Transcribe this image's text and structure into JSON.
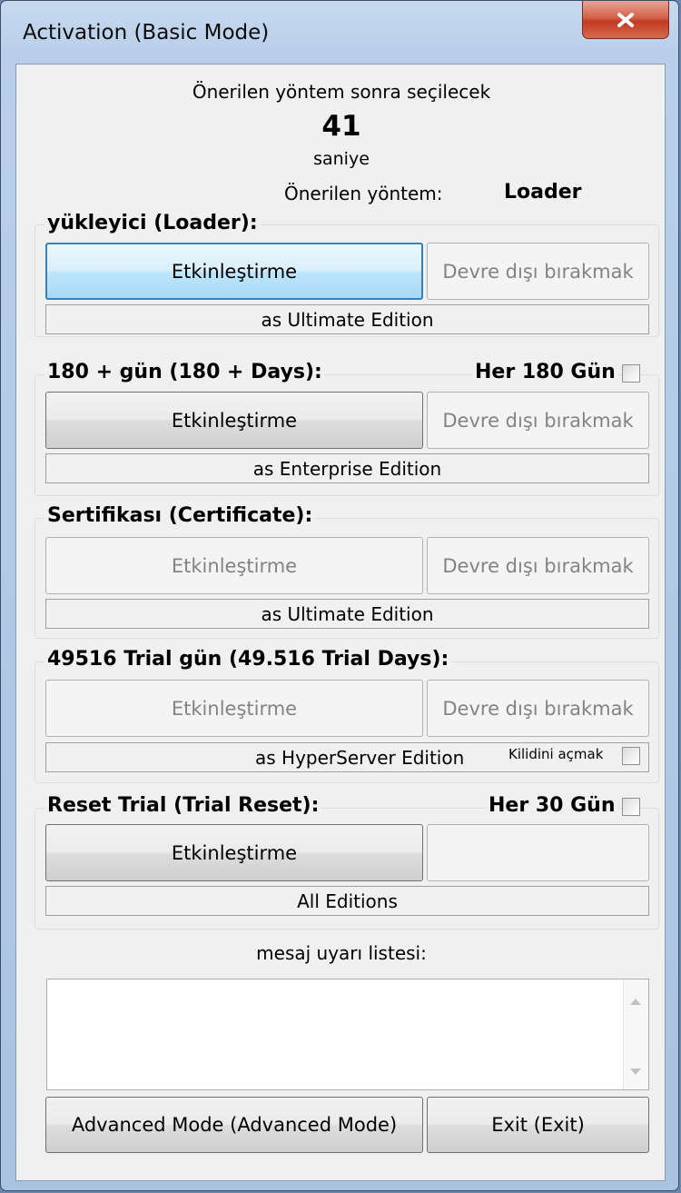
{
  "window": {
    "title": "Activation (Basic Mode)",
    "close_glyph": "x"
  },
  "countdown": {
    "label": "Önerilen yöntem sonra seçilecek",
    "seconds": "41",
    "unit": "saniye",
    "recommended_label": "Önerilen yöntem:",
    "recommended_value": "Loader"
  },
  "sections": {
    "loader": {
      "title": "yükleyici  (Loader):",
      "activate": "Etkinleştirme",
      "deactivate": "Devre dışı bırakmak",
      "edition": "as Ultimate Edition"
    },
    "days180": {
      "title": "180 +  gün (180 +  Days):",
      "check_label": "Her 180 Gün",
      "activate": "Etkinleştirme",
      "deactivate": "Devre dışı bırakmak",
      "edition": "as Enterprise Edition"
    },
    "certificate": {
      "title": "Sertifikası (Certificate):",
      "activate": "Etkinleştirme",
      "deactivate": "Devre dışı bırakmak",
      "edition": "as Ultimate Edition"
    },
    "trial49516": {
      "title": "49516 Trial gün (49.516 Trial Days):",
      "activate": "Etkinleştirme",
      "deactivate": "Devre dışı bırakmak",
      "edition": "as HyperServer Edition",
      "unlock_label": "Kilidini açmak"
    },
    "reset": {
      "title": "Reset Trial (Trial Reset):",
      "check_label": "Her 30 Gün",
      "activate": "Etkinleştirme",
      "edition": "All Editions"
    }
  },
  "messages": {
    "label": "mesaj uyarı listesi:"
  },
  "footer": {
    "advanced": "Advanced Mode (Advanced Mode)",
    "exit": "Exit (Exit)"
  }
}
